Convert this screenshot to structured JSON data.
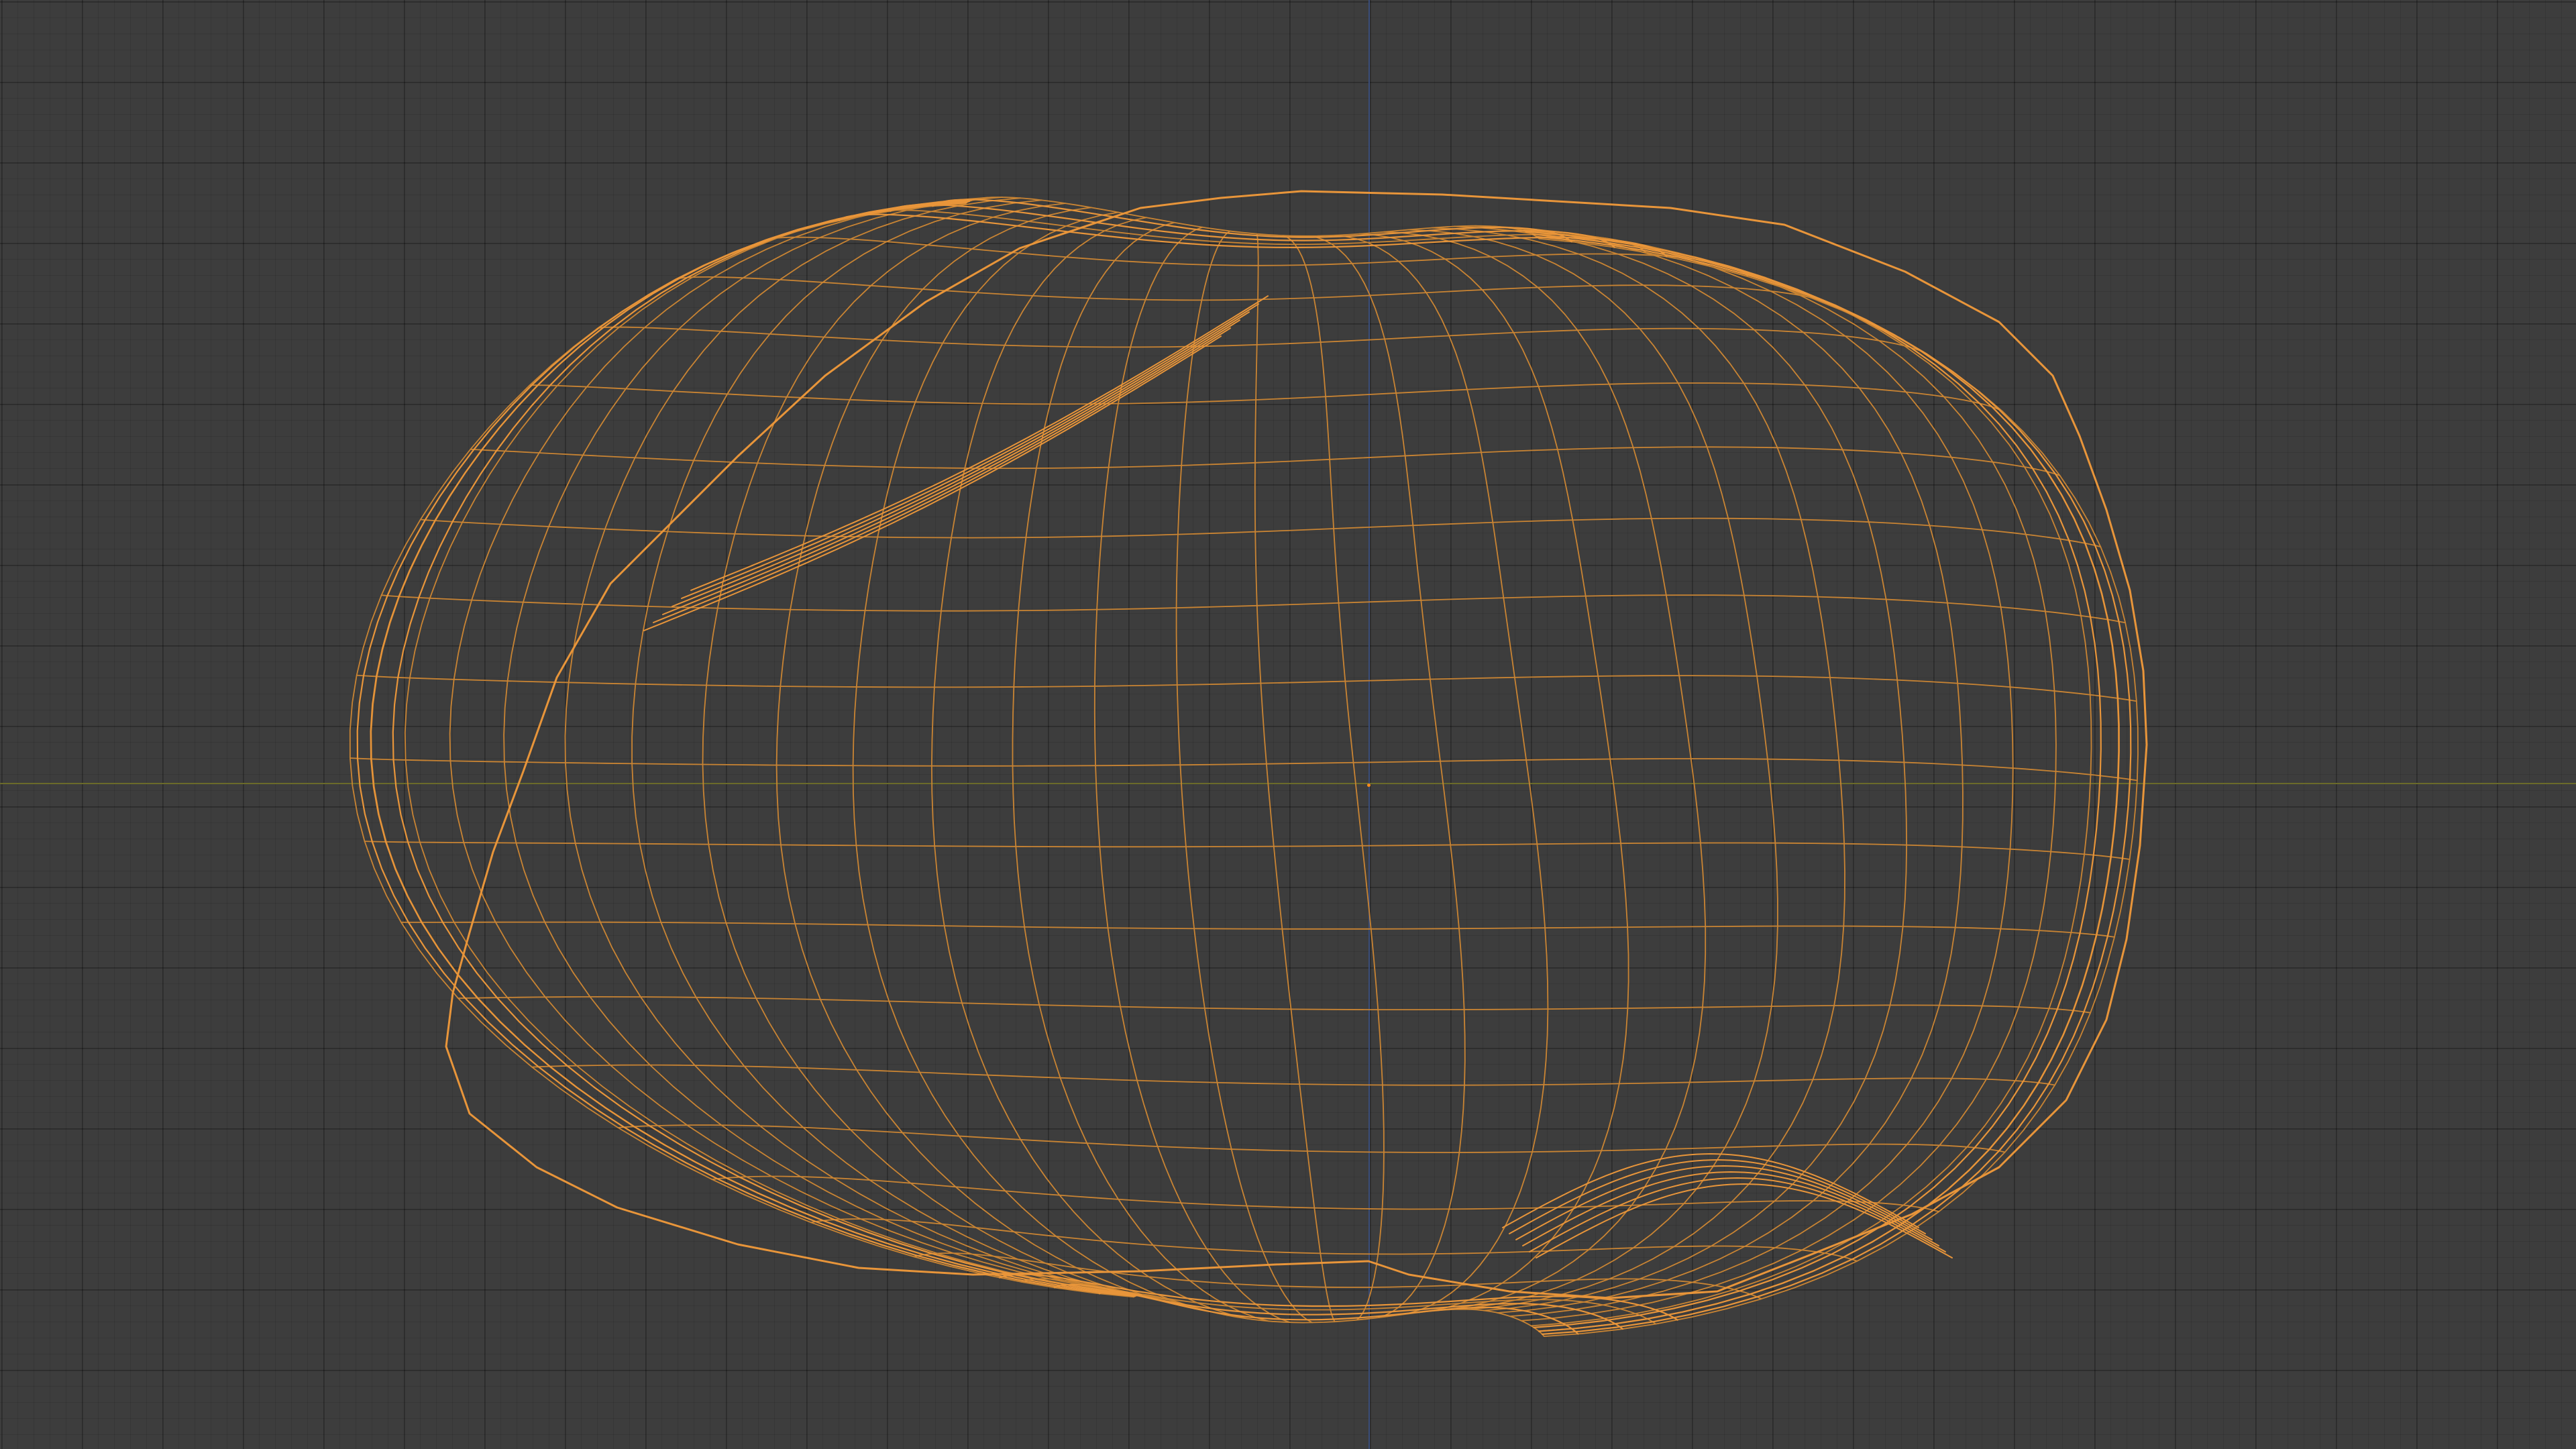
{
  "viewport": {
    "background_color": "#3d3d3d",
    "axis_x_color": "#6b6b2a",
    "axis_y_color": "#3b4e7a"
  },
  "mesh": {
    "object": "wireframe-rock",
    "selected": true,
    "wire_color": "#e8953a",
    "wire_color_dim": "#c98433"
  },
  "origin_marker": {
    "color": "#ff8c1a"
  }
}
